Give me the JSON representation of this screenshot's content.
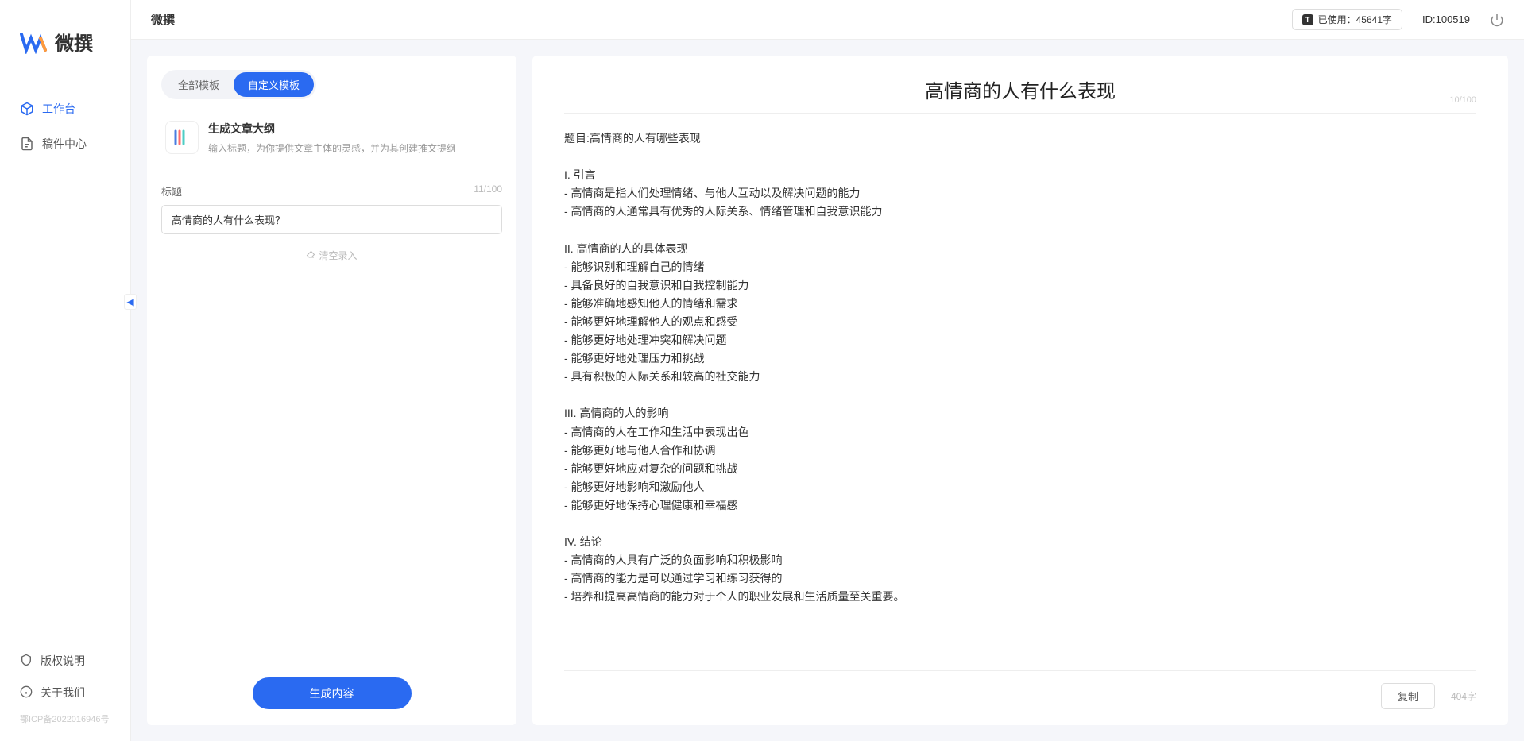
{
  "app": {
    "name": "微撰"
  },
  "sidebar": {
    "nav": [
      {
        "label": "工作台"
      },
      {
        "label": "稿件中心"
      }
    ],
    "bottom": [
      {
        "label": "版权说明"
      },
      {
        "label": "关于我们"
      }
    ],
    "icp": "鄂ICP备2022016946号"
  },
  "header": {
    "title": "微撰",
    "usage_label": "已使用：45641字",
    "user_id": "ID:100519"
  },
  "left_panel": {
    "tabs": [
      {
        "label": "全部模板"
      },
      {
        "label": "自定义模板"
      }
    ],
    "template": {
      "title": "生成文章大纲",
      "desc": "输入标题，为你提供文章主体的灵感，并为其创建推文提纲"
    },
    "form": {
      "title_label": "标题",
      "title_count": "11/100",
      "title_value": "高情商的人有什么表现？",
      "clear_label": "清空录入"
    },
    "generate_button": "生成内容"
  },
  "right_panel": {
    "title": "高情商的人有什么表现",
    "title_count": "10/100",
    "content": "题目:高情商的人有哪些表现\n\nI. 引言\n- 高情商是指人们处理情绪、与他人互动以及解决问题的能力\n- 高情商的人通常具有优秀的人际关系、情绪管理和自我意识能力\n\nII. 高情商的人的具体表现\n- 能够识别和理解自己的情绪\n- 具备良好的自我意识和自我控制能力\n- 能够准确地感知他人的情绪和需求\n- 能够更好地理解他人的观点和感受\n- 能够更好地处理冲突和解决问题\n- 能够更好地处理压力和挑战\n- 具有积极的人际关系和较高的社交能力\n\nIII. 高情商的人的影响\n- 高情商的人在工作和生活中表现出色\n- 能够更好地与他人合作和协调\n- 能够更好地应对复杂的问题和挑战\n- 能够更好地影响和激励他人\n- 能够更好地保持心理健康和幸福感\n\nIV. 结论\n- 高情商的人具有广泛的负面影响和积极影响\n- 高情商的能力是可以通过学习和练习获得的\n- 培养和提高高情商的能力对于个人的职业发展和生活质量至关重要。",
    "copy_button": "复制",
    "word_count": "404字"
  }
}
